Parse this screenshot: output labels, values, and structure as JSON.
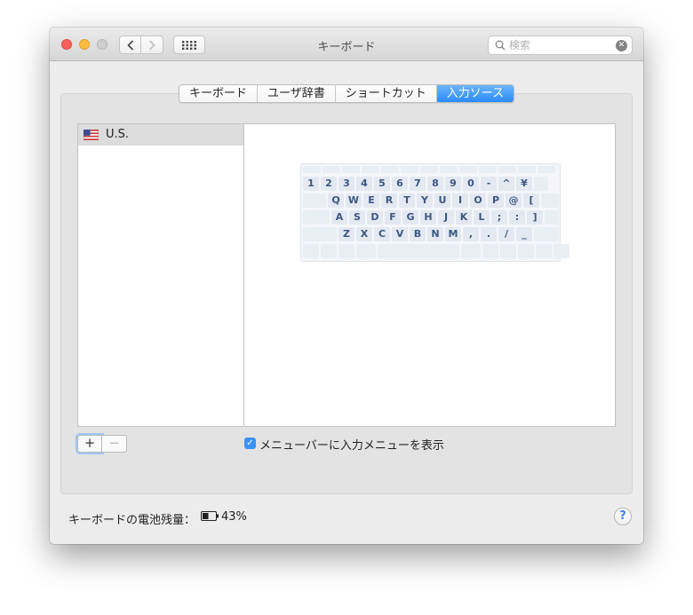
{
  "window": {
    "title": "キーボード"
  },
  "toolbar": {
    "back_label": "‹",
    "forward_label": "›"
  },
  "search": {
    "placeholder": "検索",
    "value": ""
  },
  "tabs": [
    {
      "label": "キーボード",
      "active": false
    },
    {
      "label": "ユーザ辞書",
      "active": false
    },
    {
      "label": "ショートカット",
      "active": false
    },
    {
      "label": "入力ソース",
      "active": true
    }
  ],
  "sources": {
    "items": [
      {
        "label": "U.S.",
        "selected": true
      }
    ]
  },
  "keyboard": {
    "row1": [
      "1",
      "2",
      "3",
      "4",
      "5",
      "6",
      "7",
      "8",
      "9",
      "0",
      "-",
      "^",
      "¥"
    ],
    "row2": [
      "Q",
      "W",
      "E",
      "R",
      "T",
      "Y",
      "U",
      "I",
      "O",
      "P",
      "@",
      "["
    ],
    "row3": [
      "A",
      "S",
      "D",
      "F",
      "G",
      "H",
      "J",
      "K",
      "L",
      ";",
      ":",
      "]"
    ],
    "row4": [
      "Z",
      "X",
      "C",
      "V",
      "B",
      "N",
      "M",
      ",",
      ".",
      "/",
      "_"
    ]
  },
  "buttons": {
    "add_label": "+",
    "remove_label": "−"
  },
  "options": {
    "show_input_menu_label": "メニューバーに入力メニューを表示",
    "show_input_menu_checked": true
  },
  "footer": {
    "battery_label": "キーボードの電池残量：",
    "battery_value": "43%",
    "help_label": "?"
  },
  "colors": {
    "accent": "#2a8cf7",
    "key_text": "#3c5783"
  }
}
